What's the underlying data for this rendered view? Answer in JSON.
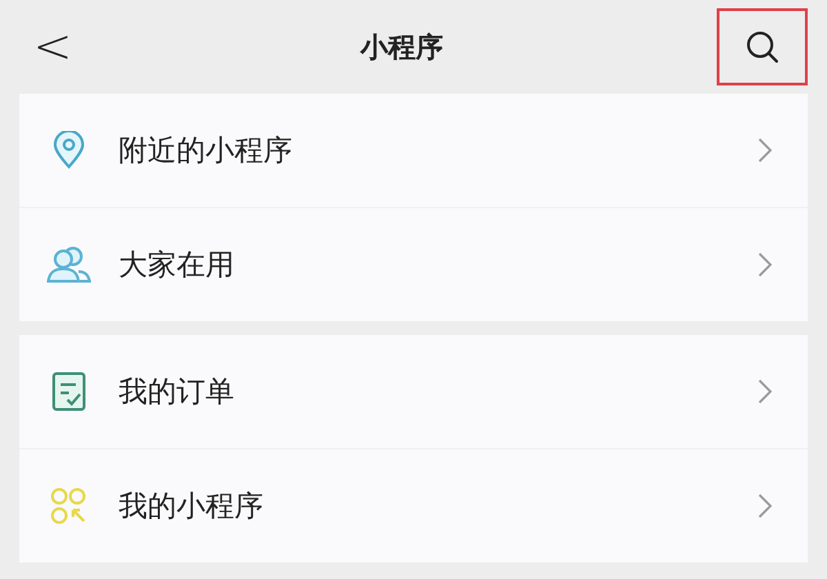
{
  "header": {
    "back_icon": "<",
    "title": "小程序",
    "search": {
      "highlighted": true
    }
  },
  "groups": [
    {
      "items": [
        {
          "label": "附近的小程序"
        },
        {
          "label": "大家在用"
        }
      ]
    },
    {
      "items": [
        {
          "label": "我的订单"
        },
        {
          "label": "我的小程序"
        }
      ]
    }
  ]
}
